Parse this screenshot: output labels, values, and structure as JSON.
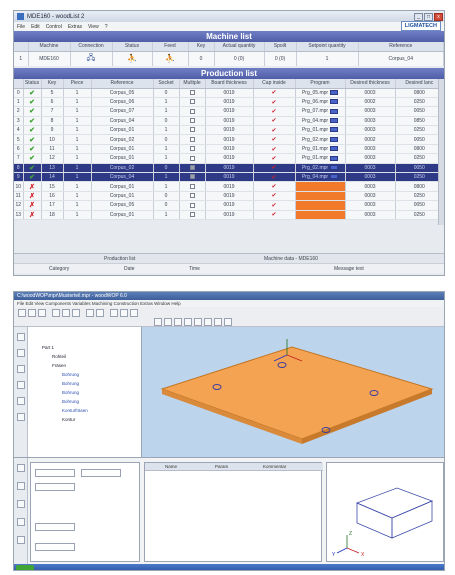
{
  "window1": {
    "title": "MDE160 - woodList 2",
    "menu": [
      "File",
      "Edit",
      "Control",
      "Extras",
      "View",
      "?"
    ],
    "logo": "LIGMATECH"
  },
  "machine_list": {
    "title": "Machine list",
    "headers": [
      "",
      "Machine",
      "Connection",
      "Status",
      "Feed",
      "Key",
      "Actual quantity",
      "Spoilt",
      "Setpoint quantity",
      "Reference"
    ],
    "rows": [
      {
        "idx": "1",
        "machine": "MDE160",
        "key": "0",
        "actual": "0 (0)",
        "spoilt": "0 (0)",
        "setpoint": "1",
        "reference": "Corpus_04"
      }
    ]
  },
  "production_list": {
    "title": "Production list",
    "headers": [
      "Status",
      "Key",
      "Piece",
      "Reference",
      "Socket",
      "Multiple",
      "Board thickness",
      "Cap inside",
      "Program",
      "Desired thickness",
      "Desired lanc"
    ],
    "rows": [
      {
        "idx": "0",
        "key": "5",
        "piece": "1",
        "ref": "Corpus_05",
        "socket": "0",
        "thick": "0019",
        "prog": "Prg_05.mpr",
        "d1": "0003",
        "d2": "0800",
        "status": "ok"
      },
      {
        "idx": "1",
        "key": "6",
        "piece": "1",
        "ref": "Corpus_06",
        "socket": "1",
        "thick": "0019",
        "prog": "Prg_06.mpr",
        "d1": "0002",
        "d2": "0250",
        "status": "ok"
      },
      {
        "idx": "2",
        "key": "7",
        "piece": "1",
        "ref": "Corpus_07",
        "socket": "1",
        "thick": "0019",
        "prog": "Prg_07.mpr",
        "d1": "0003",
        "d2": "0050",
        "status": "ok"
      },
      {
        "idx": "3",
        "key": "8",
        "piece": "1",
        "ref": "Corpus_04",
        "socket": "0",
        "thick": "0019",
        "prog": "Prg_04.mpr",
        "d1": "0003",
        "d2": "0850",
        "status": "ok"
      },
      {
        "idx": "4",
        "key": "9",
        "piece": "1",
        "ref": "Corpus_01",
        "socket": "1",
        "thick": "0019",
        "prog": "Prg_01.mpr",
        "d1": "0003",
        "d2": "0250",
        "status": "ok"
      },
      {
        "idx": "5",
        "key": "10",
        "piece": "1",
        "ref": "Corpus_02",
        "socket": "0",
        "thick": "0019",
        "prog": "Prg_02.mpr",
        "d1": "0002",
        "d2": "0050",
        "status": "ok"
      },
      {
        "idx": "6",
        "key": "11",
        "piece": "1",
        "ref": "Corpus_01",
        "socket": "1",
        "thick": "0019",
        "prog": "Prg_01.mpr",
        "d1": "0003",
        "d2": "0800",
        "status": "ok"
      },
      {
        "idx": "7",
        "key": "12",
        "piece": "1",
        "ref": "Corpus_01",
        "socket": "1",
        "thick": "0019",
        "prog": "Prg_01.mpr",
        "d1": "0003",
        "d2": "0250",
        "status": "ok"
      },
      {
        "idx": "8",
        "key": "13",
        "piece": "1",
        "ref": "Corpus_02",
        "socket": "0",
        "thick": "0019",
        "prog": "Prg_02.mpr",
        "d1": "0003",
        "d2": "0050",
        "status": "sel"
      },
      {
        "idx": "9",
        "key": "14",
        "piece": "1",
        "ref": "Corpus_04",
        "socket": "1",
        "thick": "0019",
        "prog": "Prg_04.mpr",
        "d1": "0003",
        "d2": "0250",
        "status": "sel"
      },
      {
        "idx": "10",
        "key": "15",
        "piece": "1",
        "ref": "Corpus_01",
        "socket": "1",
        "thick": "0019",
        "prog": "",
        "d1": "0003",
        "d2": "0800",
        "status": "pending"
      },
      {
        "idx": "11",
        "key": "16",
        "piece": "1",
        "ref": "Corpus_01",
        "socket": "0",
        "thick": "0019",
        "prog": "",
        "d1": "0003",
        "d2": "0250",
        "status": "pending"
      },
      {
        "idx": "12",
        "key": "17",
        "piece": "1",
        "ref": "Corpus_05",
        "socket": "0",
        "thick": "0019",
        "prog": "",
        "d1": "0003",
        "d2": "0050",
        "status": "pending"
      },
      {
        "idx": "13",
        "key": "18",
        "piece": "1",
        "ref": "Corpus_01",
        "socket": "1",
        "thick": "0019",
        "prog": "",
        "d1": "0003",
        "d2": "0250",
        "status": "pending"
      }
    ]
  },
  "bottom": {
    "tab_left": "Production list",
    "tab_right": "Machine data - MDE160",
    "status_headers": [
      "Category",
      "Date",
      "Time",
      "Message text"
    ]
  },
  "window2": {
    "title": "C:\\woodWOP\\mpr\\Musterteil.mpr - woodWOP 6.0",
    "menu": "File  Edit  View  Components  Variables  Machining  Construction  Extras  Window  Help",
    "tree_items": [
      "Part 1",
      "Rohteil",
      "Fräsen",
      "Bohrung",
      "Bohrung",
      "Bohrung",
      "Bohrung",
      "Konturfräsen",
      "Kontur"
    ],
    "bottom_label": "Name",
    "table_col2": "Param",
    "table_col3": "Kommentar",
    "axis_x": "X",
    "axis_y": "Y",
    "axis_z": "Z"
  },
  "colors": {
    "header_blue": "#4f5da8",
    "selection": "#2f3a86",
    "orange": "#f07a2a",
    "panel_orange": "#f4a352",
    "viewport_bg": "#bcd4ec"
  }
}
